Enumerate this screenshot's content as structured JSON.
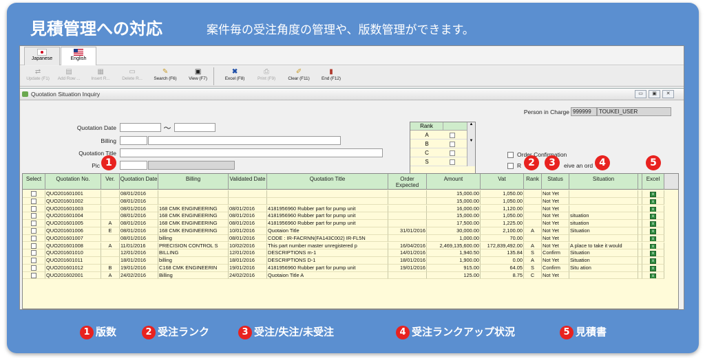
{
  "header": {
    "title": "見積管理への対応",
    "subtitle": "案件毎の受注角度の管理や、版数管理ができます。"
  },
  "languages": [
    {
      "label": "Japanese"
    },
    {
      "label": "English"
    }
  ],
  "toolbar": [
    {
      "label": "Update (F1)",
      "icon": "update-icon"
    },
    {
      "label": "Add Row ...",
      "icon": "add-row-icon"
    },
    {
      "label": "Insert R...",
      "icon": "insert-row-icon"
    },
    {
      "label": "Delete R...",
      "icon": "delete-row-icon"
    },
    {
      "label": "Search (F6)",
      "icon": "search-icon"
    },
    {
      "label": "View (F7)",
      "icon": "view-icon"
    },
    {
      "label": "Excel (F8)",
      "icon": "excel-icon"
    },
    {
      "label": "Print (F9)",
      "icon": "print-icon"
    },
    {
      "label": "Clear (F11)",
      "icon": "clear-icon"
    },
    {
      "label": "End (F12)",
      "icon": "end-icon"
    }
  ],
  "window": {
    "title": "Quotation Situation Inquiry"
  },
  "form": {
    "person_label": "Person in Charge",
    "person_code": "999999",
    "person_name": "TOUKEI_USER",
    "quotation_date_label": "Quotation Date",
    "tilde": "～",
    "billing_label": "Billing",
    "quotation_title_label": "Quotation Title",
    "pic_label": "Pic",
    "rank_header": "Rank",
    "ranks": [
      "A",
      "B",
      "C",
      "S"
    ],
    "order_confirmation_label": "Order Confirmation",
    "receive_label_fragment": "R",
    "receive_label_end": "eive an ord"
  },
  "grid": {
    "columns": [
      "Select",
      "Quotation No.",
      "Ver.",
      "Quotation Date",
      "Billing",
      "Validated Date",
      "Quotation Title",
      "Order Expected",
      "Amount",
      "Vat",
      "Rank",
      "Status",
      "Situation",
      "",
      "Excel"
    ],
    "rows": [
      [
        "QUO201601001",
        "",
        "08/01/2016",
        "",
        "",
        "",
        "",
        "15,000.00",
        "1,050.00",
        "",
        "Not Yet",
        ""
      ],
      [
        "QUO201601002",
        "",
        "08/01/2016",
        "",
        "",
        "",
        "",
        "15,000.00",
        "1,050.00",
        "",
        "Not Yet",
        ""
      ],
      [
        "QUO201601003",
        "",
        "08/01/2016",
        "168 CMK ENGINEERING",
        "08/01/2016",
        "4181956960 Rubber part for pump unit",
        "",
        "16,000.00",
        "1,120.00",
        "",
        "Not Yet",
        ""
      ],
      [
        "QUO201601004",
        "",
        "08/01/2016",
        "168 CMK ENGINEERING",
        "08/01/2016",
        "4181956960 Rubber part for pump unit",
        "",
        "15,000.00",
        "1,050.00",
        "",
        "Not Yet",
        "situation"
      ],
      [
        "QUO201601005",
        "A",
        "08/01/2016",
        "168 CMK ENGINEERING",
        "08/01/2016",
        "4181956960 Rubber part for pump unit",
        "",
        "17,500.00",
        "1,225.00",
        "",
        "Not Yet",
        "situation"
      ],
      [
        "QUO201601006",
        "E",
        "08/01/2016",
        "168 CMK ENGINEERING",
        "10/01/2016",
        "Quotaion Title",
        "31/01/2016",
        "30,000.00",
        "2,100.00",
        "A",
        "Not Yet",
        "Situation"
      ],
      [
        "QUO201601007",
        "",
        "08/01/2016",
        "billing",
        "08/01/2016",
        "CODE : IR-FACRNN(FA143C002) IR-FL5N",
        "",
        "1,000.00",
        "70.00",
        "",
        "Not Yet",
        ""
      ],
      [
        "QUO201601008",
        "A",
        "11/01/2016",
        "PRECISION CONTROL S",
        "10/02/2016",
        "This part number master unregistered p",
        "16/04/2016",
        "2,469,135,600.00",
        "172,839,492.00",
        "A",
        "Not Yet",
        "A place to take it would"
      ],
      [
        "QUO201601010",
        "",
        "12/01/2016",
        "BILLING",
        "12/01/2016",
        "DESCRIPTIONS m-1",
        "14/01/2016",
        "1,940.50",
        "135.84",
        "S",
        "Confirm",
        "Situation"
      ],
      [
        "QUO201601011",
        "",
        "18/01/2016",
        "billing",
        "18/01/2016",
        "DESCRIPTIONS D-1",
        "18/01/2016",
        "1,900.00",
        "0.00",
        "A",
        "Not Yet",
        "Situation"
      ],
      [
        "QUO201601012",
        "B",
        "19/01/2016",
        "C168 CMK ENGINEERIN",
        "19/01/2016",
        "4181956960 Rubber part for pump unit",
        "19/01/2016",
        "915.00",
        "64.05",
        "S",
        "Confirm",
        "Situ    ation"
      ],
      [
        "QUO201602001",
        "A",
        "24/02/2016",
        "Billing",
        "24/02/2016",
        "Quotaion Title A",
        "",
        "125.00",
        "8.75",
        "C",
        "Not Yet",
        ""
      ]
    ]
  },
  "legend": [
    {
      "num": "1",
      "text": "版数"
    },
    {
      "num": "2",
      "text": "受注ランク"
    },
    {
      "num": "3",
      "text": "受注/失注/未受注"
    },
    {
      "num": "4",
      "text": "受注ランクアップ状況"
    },
    {
      "num": "5",
      "text": "見積書"
    }
  ],
  "colors": {
    "frame": "#5b8fd0",
    "badge": "#e8221f",
    "grid_header": "#cfeccb",
    "grid_body": "#fffbd9"
  }
}
